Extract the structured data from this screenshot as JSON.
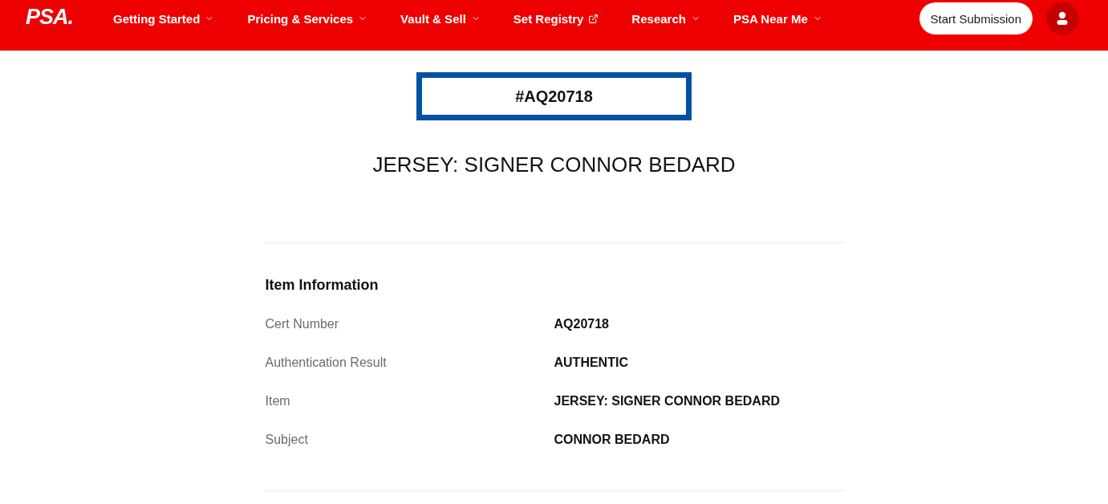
{
  "header": {
    "logo": "PSA.",
    "nav": [
      {
        "label": "Getting Started",
        "kind": "dropdown"
      },
      {
        "label": "Pricing & Services",
        "kind": "dropdown"
      },
      {
        "label": "Vault & Sell",
        "kind": "dropdown"
      },
      {
        "label": "Set Registry",
        "kind": "external"
      },
      {
        "label": "Research",
        "kind": "dropdown"
      },
      {
        "label": "PSA Near Me",
        "kind": "dropdown"
      }
    ],
    "cta": "Start Submission"
  },
  "cert_badge": "#AQ20718",
  "title": "JERSEY: SIGNER CONNOR BEDARD",
  "item_information": {
    "heading": "Item Information",
    "rows": [
      {
        "label": "Cert Number",
        "value": "AQ20718"
      },
      {
        "label": "Authentication Result",
        "value": "AUTHENTIC"
      },
      {
        "label": "Item",
        "value": "JERSEY: SIGNER CONNOR BEDARD"
      },
      {
        "label": "Subject",
        "value": "CONNOR BEDARD"
      }
    ]
  }
}
